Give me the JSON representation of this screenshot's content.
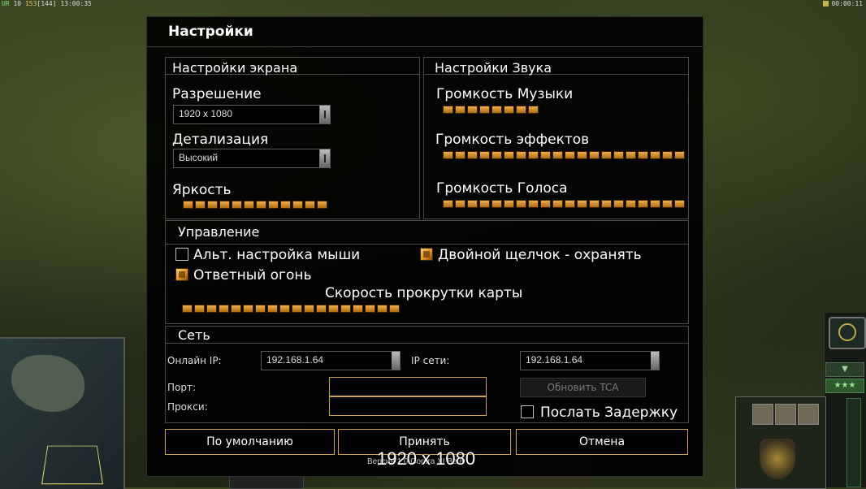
{
  "hud": {
    "left_a": "UR",
    "left_b": "10",
    "left_c": "153",
    "left_d": "[144]",
    "left_time": "13:00:35",
    "right_time": "00:00:11"
  },
  "dialog": {
    "title": "Настройки",
    "screen": {
      "title": "Настройки экрана",
      "resolution_label": "Разрешение",
      "resolution_value": "1920 x 1080",
      "detail_label": "Детализация",
      "detail_value": "Высокий",
      "brightness_label": "Яркость",
      "brightness_level": 12
    },
    "sound": {
      "title": "Настройки Звука",
      "music_label": "Громкость Музыки",
      "music_level": 8,
      "effects_label": "Громкость эффектов",
      "effects_level": 20,
      "voice_label": "Громкость Голоса",
      "voice_level": 20
    },
    "controls": {
      "title": "Управление",
      "alt_mouse_label": "Альт. настройка мыши",
      "alt_mouse_checked": false,
      "double_click_label": "Двойной щелчок - охранять",
      "double_click_checked": true,
      "return_fire_label": "Ответный огонь",
      "return_fire_checked": true,
      "scroll_speed_label": "Скорость прокрутки карты",
      "scroll_speed_level": 18
    },
    "network": {
      "title": "Сеть",
      "online_ip_label": "Онлайн IP:",
      "online_ip_value": "192.168.1.64",
      "lan_ip_label": "IP сети:",
      "lan_ip_value": "192.168.1.64",
      "port_label": "Порт:",
      "port_value": "",
      "proxy_label": "Прокси:",
      "proxy_value": "",
      "update_button": "Обновить TCA",
      "send_delay_label": "Послать Задержку",
      "send_delay_checked": false
    },
    "buttons": {
      "defaults": "По умолчанию",
      "accept": "Принять",
      "cancel": "Отмена"
    }
  },
  "overlay": {
    "resolution_text": "1920 x 1080",
    "version_text": "Версия 1.0 Contra XI Beta"
  },
  "colors": {
    "accent_border": "#c9a64e",
    "slider_fill": "#e08a1a"
  }
}
